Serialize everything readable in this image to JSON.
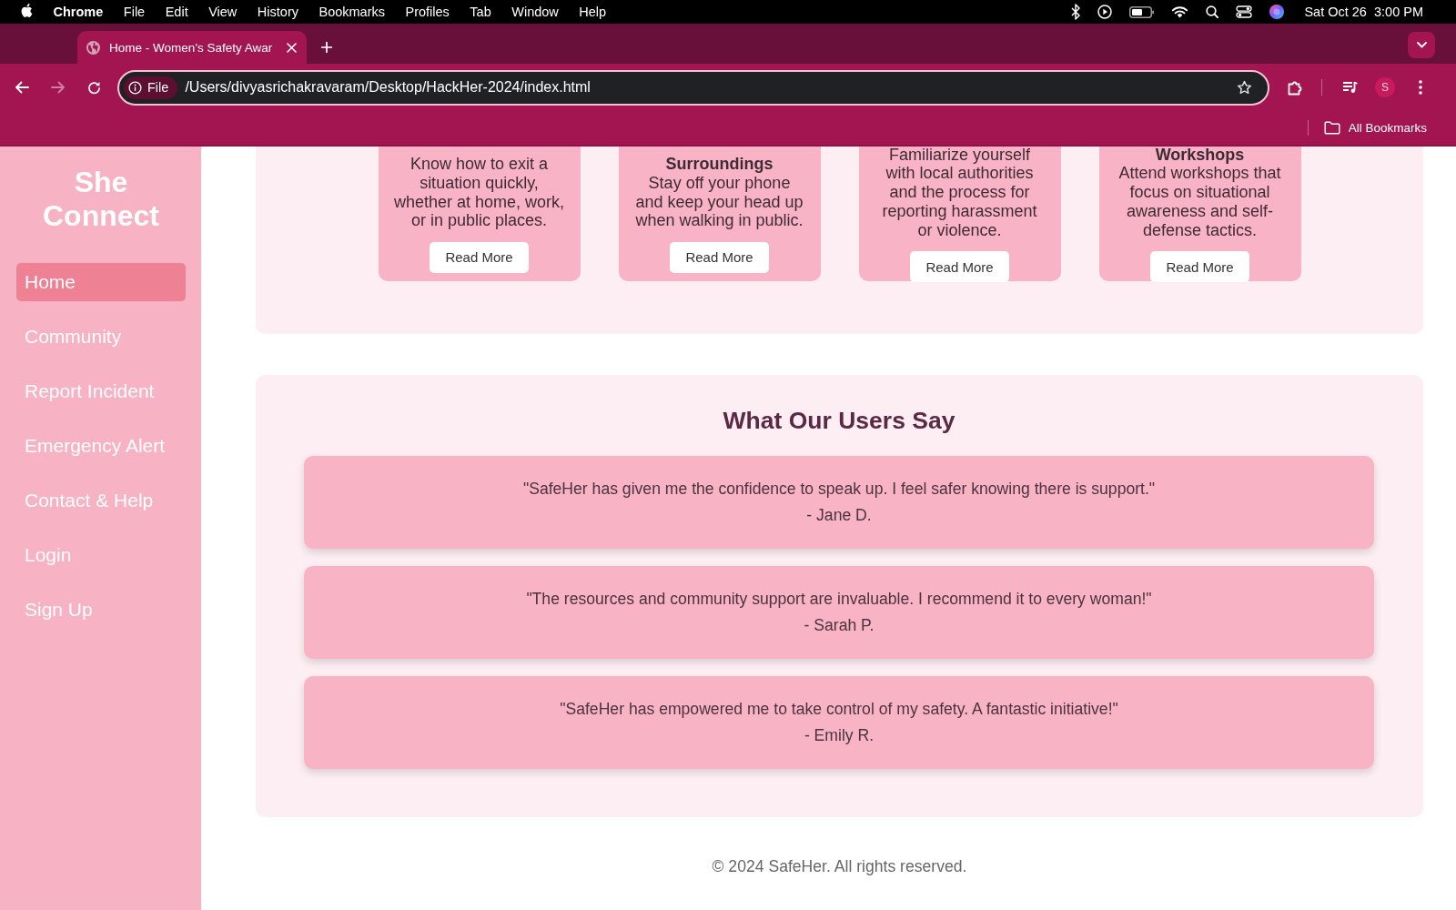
{
  "menu_bar": {
    "app": "Chrome",
    "menus": [
      "File",
      "Edit",
      "View",
      "History",
      "Bookmarks",
      "Profiles",
      "Tab",
      "Window",
      "Help"
    ],
    "clock": "Sat Oct 26  3:00 PM"
  },
  "browser": {
    "tabs": [
      {
        "title": "Home - Women’s Safety Awar",
        "selected": true
      }
    ],
    "toolbar": {
      "back": {
        "disabled": false
      },
      "forward": {
        "disabled": true
      },
      "site_chip": "File",
      "url": "/Users/divyasrichakravaram/Desktop/HackHer-2024/index.html",
      "profile_initial": "S"
    },
    "bookmarks_bar": {
      "folder": "All Bookmarks"
    }
  },
  "sidebar": {
    "logo": "She Connect",
    "items": [
      {
        "label": "Home",
        "selected": true
      },
      {
        "label": "Community",
        "selected": false
      },
      {
        "label": "Report Incident",
        "selected": false
      },
      {
        "label": "Emergency Alert",
        "selected": false
      },
      {
        "label": "Contact & Help",
        "selected": false
      },
      {
        "label": "Login",
        "selected": false
      },
      {
        "label": "Sign Up",
        "selected": false
      }
    ]
  },
  "safety_tips": {
    "cards": [
      {
        "body": "Know how to exit a situation quickly, whether at home, work, or in public places.",
        "button": "Read More"
      },
      {
        "title": "Surroundings",
        "body": "Stay off your phone and keep your head up when walking in public.",
        "button": "Read More"
      },
      {
        "body": "Familiarize yourself with local authorities and the process for reporting harassment or violence.",
        "button": "Read More"
      },
      {
        "title": "Workshops",
        "body": "Attend workshops that focus on situational awareness and self-defense tactics.",
        "button": "Read More"
      }
    ]
  },
  "testimonials": {
    "heading": "What Our Users Say",
    "items": [
      {
        "quote": "\"SafeHer has given me the confidence to speak up. I feel safer knowing there is support.\"",
        "author": "- Jane D."
      },
      {
        "quote": "\"The resources and community support are invaluable. I recommend it to every woman!\"",
        "author": "- Sarah P."
      },
      {
        "quote": "\"SafeHer has empowered me to take control of my safety. A fantastic initiative!\"",
        "author": "- Emily R."
      }
    ]
  },
  "footer": "© 2024 SafeHer. All rights reserved."
}
